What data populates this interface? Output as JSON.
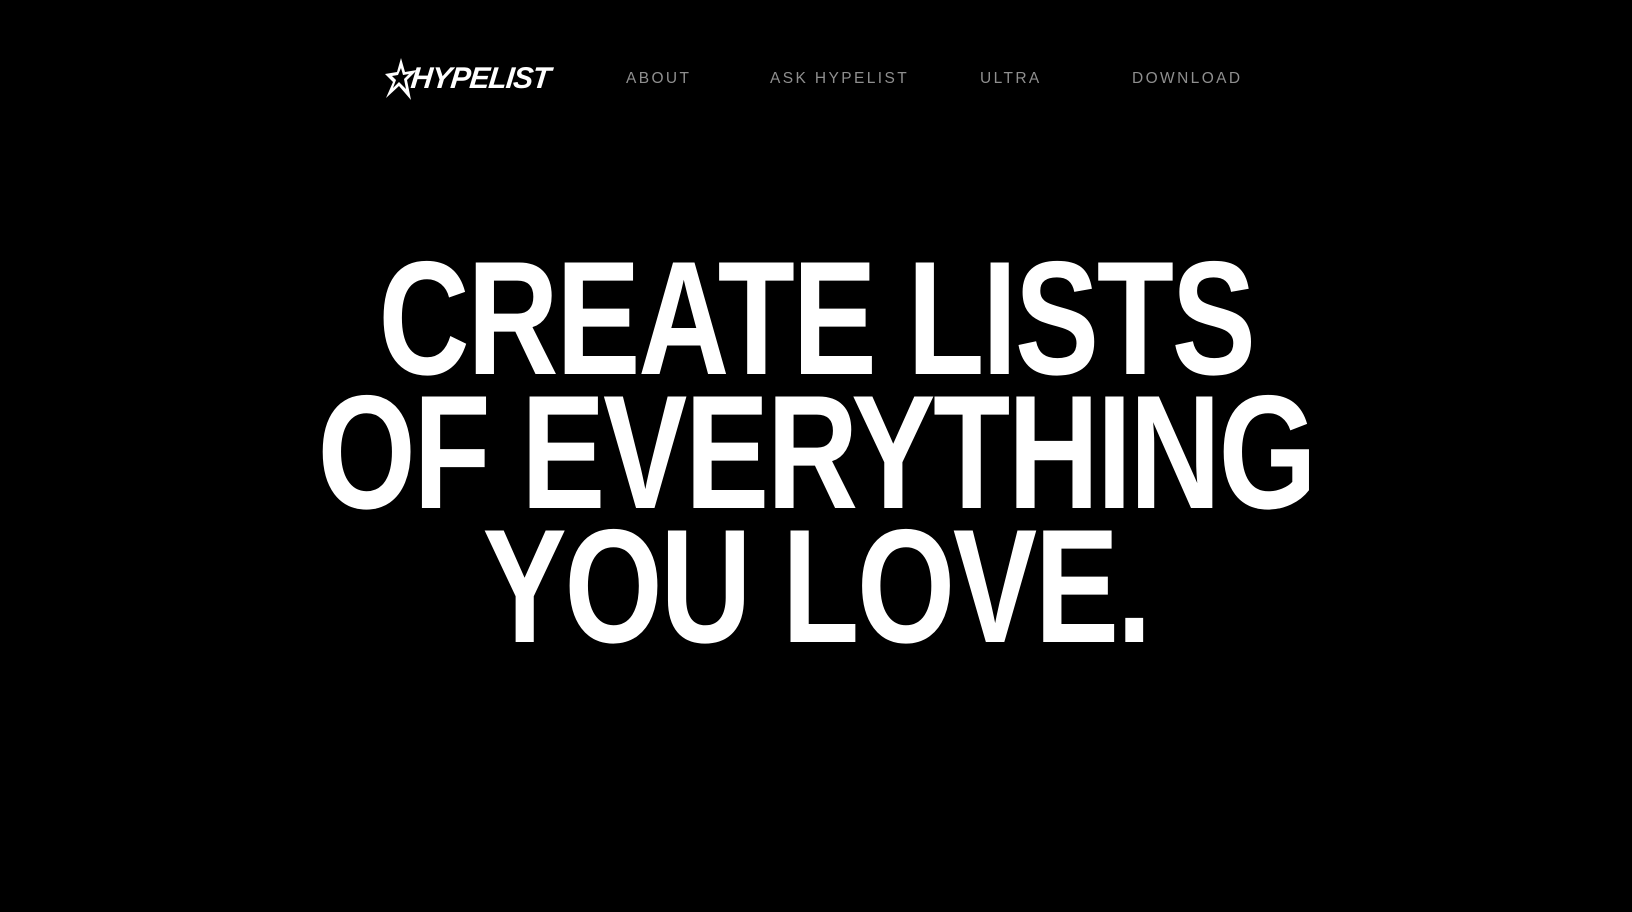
{
  "brand": {
    "logo_text": "HYPELIST",
    "logo_icon": "star-icon"
  },
  "nav": {
    "items": [
      {
        "label": "ABOUT"
      },
      {
        "label": "ASK HYPELIST"
      },
      {
        "label": "ULTRA"
      },
      {
        "label": "DOWNLOAD"
      }
    ]
  },
  "hero": {
    "lines": [
      "CREATE LISTS",
      "OF EVERYTHING",
      "YOU LOVE."
    ]
  },
  "colors": {
    "background": "#000000",
    "text": "#ffffff",
    "nav_text": "#8f8f8f"
  }
}
